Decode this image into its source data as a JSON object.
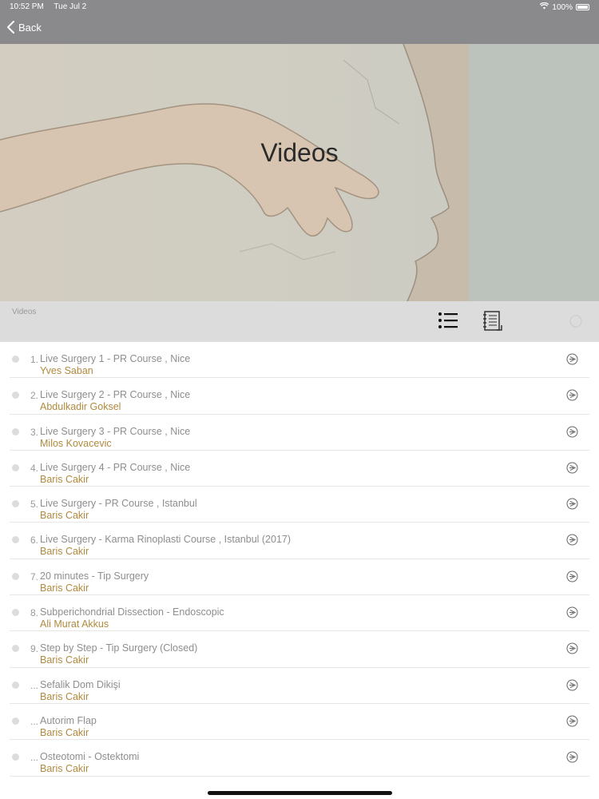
{
  "status_bar": {
    "time": "10:52 PM",
    "date": "Tue Jul 2",
    "battery": "100%"
  },
  "nav": {
    "back_label": "Back"
  },
  "hero": {
    "title": "Videos"
  },
  "toolbar": {
    "caption": "Videos"
  },
  "colors": {
    "title": "#8e8e8e",
    "author": "#b08a3e",
    "nav": "#8a8a8d"
  },
  "videos": [
    {
      "number": "1.",
      "title": "Live Surgery 1 - PR Course , Nice",
      "author": "Yves Saban"
    },
    {
      "number": "2.",
      "title": "Live Surgery 2 - PR Course , Nice",
      "author": "Abdulkadir Goksel"
    },
    {
      "number": "3.",
      "title": "Live Surgery 3 - PR Course , Nice",
      "author": "Milos Kovacevic"
    },
    {
      "number": "4.",
      "title": "Live Surgery 4 - PR Course , Nice",
      "author": "Baris Cakir"
    },
    {
      "number": "5.",
      "title": "Live Surgery - PR Course , Istanbul",
      "author": "Baris Cakir"
    },
    {
      "number": "6.",
      "title": "Live Surgery - Karma Rinoplasti Course , Istanbul (2017)",
      "author": "Baris Cakir"
    },
    {
      "number": "7.",
      "title": "20 minutes - Tip Surgery",
      "author": "Baris Cakir"
    },
    {
      "number": "8.",
      "title": "Subperichondrial Dissection - Endoscopic",
      "author": "Ali Murat Akkus"
    },
    {
      "number": "9.",
      "title": "Step by Step - Tip Surgery (Closed)",
      "author": "Baris Cakir"
    },
    {
      "number": "...",
      "title": "Sefalik Dom Dikişi",
      "author": "Baris Cakir"
    },
    {
      "number": "...",
      "title": "Autorim Flap",
      "author": "Baris Cakir"
    },
    {
      "number": "...",
      "title": "Osteotomi - Ostektomi",
      "author": "Baris Cakir"
    }
  ]
}
